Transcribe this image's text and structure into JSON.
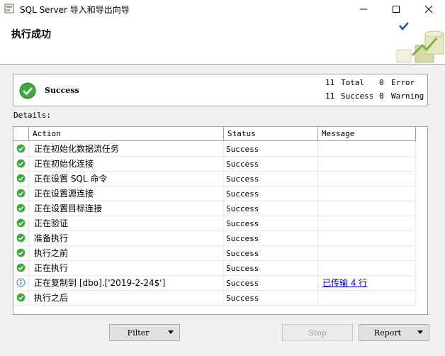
{
  "window": {
    "title": "SQL Server 导入和导出向导",
    "icon": "app-icon"
  },
  "header": {
    "title": "执行成功"
  },
  "summary": {
    "status": "Success",
    "total_count": "11",
    "total_label": "Total",
    "success_count": "11",
    "success_label": "Success",
    "error_count": "0",
    "error_label": "Error",
    "warning_count": "0",
    "warning_label": "Warning"
  },
  "details_label": "Details:",
  "grid": {
    "columns": [
      "Action",
      "Status",
      "Message"
    ],
    "rows": [
      {
        "icon": "success-icon",
        "action": "正在初始化数据流任务",
        "status": "Success",
        "message": ""
      },
      {
        "icon": "success-icon",
        "action": "正在初始化连接",
        "status": "Success",
        "message": ""
      },
      {
        "icon": "success-icon",
        "action": "正在设置 SQL 命令",
        "status": "Success",
        "message": ""
      },
      {
        "icon": "success-icon",
        "action": "正在设置源连接",
        "status": "Success",
        "message": ""
      },
      {
        "icon": "success-icon",
        "action": "正在设置目标连接",
        "status": "Success",
        "message": ""
      },
      {
        "icon": "success-icon",
        "action": "正在验证",
        "status": "Success",
        "message": ""
      },
      {
        "icon": "success-icon",
        "action": "准备执行",
        "status": "Success",
        "message": ""
      },
      {
        "icon": "success-icon",
        "action": "执行之前",
        "status": "Success",
        "message": ""
      },
      {
        "icon": "success-icon",
        "action": "正在执行",
        "status": "Success",
        "message": ""
      },
      {
        "icon": "info-icon",
        "action": "正在复制到 [dbo].['2019-2-24$']",
        "status": "Success",
        "message": "已传输 4 行"
      },
      {
        "icon": "success-icon",
        "action": "执行之后",
        "status": "Success",
        "message": ""
      }
    ]
  },
  "buttons": {
    "filter": "Filter",
    "stop": "Stop",
    "report": "Report"
  },
  "colors": {
    "success_green": "#3aa83a",
    "info_blue": "#2a6fc9",
    "link_blue": "#0000ee"
  }
}
